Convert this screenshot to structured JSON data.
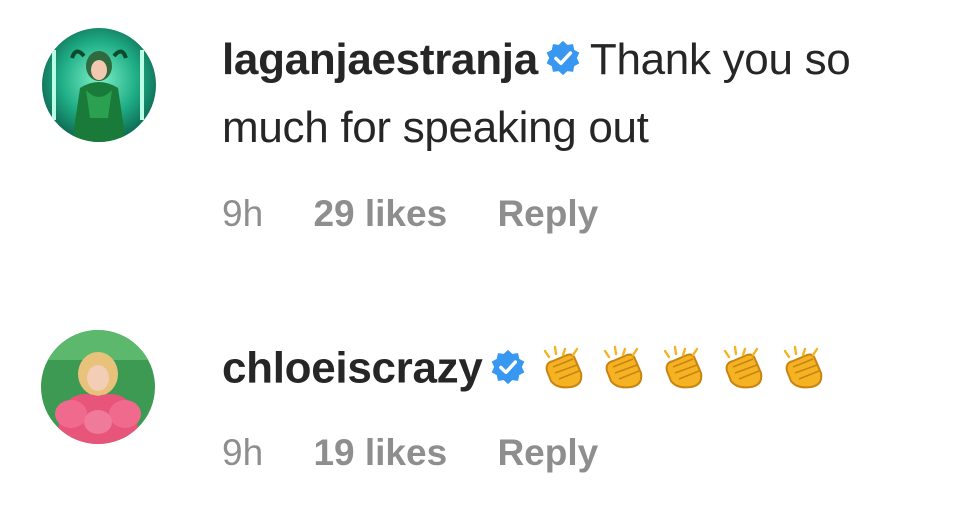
{
  "comments": [
    {
      "username": "laganjaestranja",
      "text": "Thank you so much for speaking out",
      "time": "9h",
      "likes": "29 likes",
      "reply": "Reply",
      "avatar_icon": "profile-photo-green",
      "verified_icon": "verified-badge-icon"
    },
    {
      "username": "chloeiscrazy",
      "text": "👏👏👏👏👏",
      "time": "9h",
      "likes": "19 likes",
      "reply": "Reply",
      "avatar_icon": "profile-photo-pink",
      "verified_icon": "verified-badge-icon"
    }
  ],
  "colors": {
    "text": "#262626",
    "meta": "#8e8e8e",
    "verified": "#3897f0",
    "clap": "#f5b324"
  }
}
